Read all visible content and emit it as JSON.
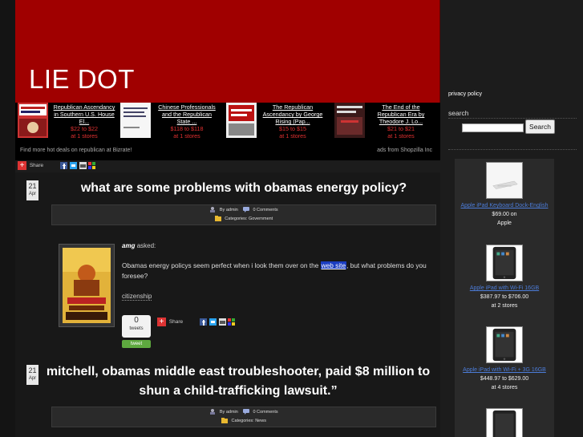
{
  "site": {
    "title": "LIE DOT"
  },
  "shop_bar": {
    "items": [
      {
        "title": "Republican Ascendancy in Southern U.S. House El...",
        "price": "$22 to $22",
        "stores": "at 1 stores"
      },
      {
        "title": "Chinese Professionals and the Republican State ...",
        "price": "$118 to $118",
        "stores": "at 1 stores"
      },
      {
        "title": "The Republican Ascendancy by George Rising (Pap...",
        "price": "$15 to $15",
        "stores": "at 1 stores"
      },
      {
        "title": "The End of the Republican Era by Theodore J. Lo...",
        "price": "$21 to $21",
        "stores": "at 1 stores"
      }
    ],
    "footer_left": "Find more hot deals on republican at Bizrate!",
    "footer_right": "ads from Shopzilla Inc"
  },
  "share": {
    "label": "Share"
  },
  "posts": [
    {
      "day": "21",
      "month": "Apr",
      "title": "what are some problems with obamas energy policy?",
      "by": "By admin",
      "comments": "0 Comments",
      "categories": "Categories: Government",
      "asker_name": "amg",
      "asker_suffix": "asked:",
      "question_before": "Obamas energy policys seem perfect when i look them over on the",
      "question_link": "web site",
      "question_after": ", but what problems do you foresee?",
      "tag": "citizenship",
      "tweets": "0",
      "tweets_word": "tweets",
      "tweet_btn": "tweet"
    },
    {
      "day": "21",
      "month": "Apr",
      "title": "mitchell, obamas middle east troubleshooter, paid $8 million to shun a child-trafficking lawsuit.”",
      "by": "By admin",
      "comments": "0 Comments",
      "categories": "Categories: News"
    }
  ],
  "sidebar": {
    "privacy": "privacy policy",
    "search_label": "search",
    "search_placeholder": "",
    "search_button": "Search",
    "products": [
      {
        "name": "Apple iPad Keyboard Dock-English",
        "price": "$69.00 on",
        "seller": "Apple"
      },
      {
        "name": "Apple iPad with Wi-Fi 16GB",
        "price": "$387.97 to $706.00",
        "seller": "at 2 stores"
      },
      {
        "name": "Apple iPad with Wi-Fi + 3G 16GB",
        "price": "$448.97 to $629.00",
        "seller": "at 4 stores"
      }
    ]
  },
  "colors": {
    "header_red": "#a00000",
    "link_blue": "#4c7cd8",
    "price_red": "#e03030",
    "tweet_green": "#5ea93f"
  }
}
